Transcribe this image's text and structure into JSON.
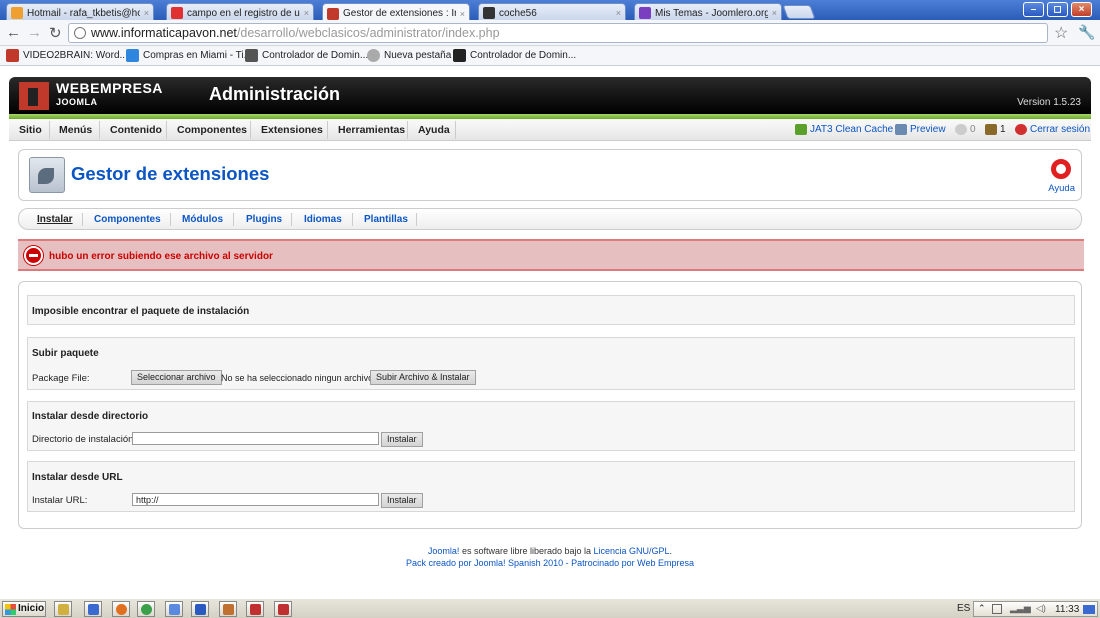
{
  "browser": {
    "tabs": [
      {
        "title": "Hotmail - rafa_tkbetis@hotmai",
        "favicon_color": "#f0a030"
      },
      {
        "title": "campo en el registro de usuari",
        "favicon_color": "#e03030"
      },
      {
        "title": "Gestor de extensiones : Instal",
        "favicon_color": "#c0392b",
        "active": true
      },
      {
        "title": "coche56",
        "favicon_color": "#333333"
      },
      {
        "title": "Mis Temas - Joomlero.org",
        "favicon_color": "#7a3ec0"
      }
    ],
    "tab_close_glyph": "×",
    "url_host": "www.informaticapavon.net",
    "url_path": "/desarrollo/webclasicos/administrator/index.php",
    "bookmarks": [
      {
        "label": "VIDEO2BRAIN: Word...",
        "icon_color": "#c0392b"
      },
      {
        "label": "Compras en Miami - Ti...",
        "icon_color": "#2e86de"
      },
      {
        "label": "Controlador de Domin...",
        "icon_color": "#555555"
      },
      {
        "label": "Nueva pestaña",
        "icon_color": "#aaaaaa"
      },
      {
        "label": "Controlador de Domin...",
        "icon_color": "#222222"
      }
    ]
  },
  "joomla": {
    "brand": "WEBEMPRESA",
    "brand_sub": "JOOMLA",
    "admin_title": "Administración",
    "version": "Version 1.5.23",
    "menu": [
      "Sitio",
      "Menús",
      "Contenido",
      "Componentes",
      "Extensiones",
      "Herramientas",
      "Ayuda"
    ],
    "status": {
      "cache": "JAT3 Clean Cache",
      "preview": "Preview",
      "messages": "0",
      "users": "1",
      "logout": "Cerrar sesión"
    },
    "page_title": "Gestor de extensiones",
    "help_label": "Ayuda",
    "submenu": [
      "Instalar",
      "Componentes",
      "Módulos",
      "Plugins",
      "Idiomas",
      "Plantillas"
    ],
    "error_message": "hubo un error subiendo ese archivo al servidor",
    "install": {
      "notice": "Imposible encontrar el paquete de instalación",
      "upload": {
        "title": "Subir paquete",
        "label": "Package File:",
        "select_button": "Seleccionar archivo",
        "no_file": "No se ha seleccionado ningun archivo",
        "submit_button": "Subir Archivo & Instalar"
      },
      "directory": {
        "title": "Instalar desde directorio",
        "label": "Directorio de instalación:",
        "value": "",
        "button": "Instalar"
      },
      "url": {
        "title": "Instalar desde URL",
        "label": "Instalar URL:",
        "value": "http://",
        "button": "Instalar"
      }
    },
    "footer": {
      "line1_pre": "Joomla!",
      "line1_mid": " es software libre liberado bajo la ",
      "line1_link": "Licencia GNU/GPL",
      "line1_end": ".",
      "line2": "Pack creado por Joomla! Spanish 2010 - Patrocinado por Web Empresa"
    }
  },
  "taskbar": {
    "start": "Inicio",
    "lang": "ES",
    "clock": "11:33",
    "items": [
      "#d0b040",
      "#3a6ad0",
      "#e07020",
      "#3aa04a",
      "#5a8ae0",
      "#2a5ac0",
      "#c07030",
      "#c03030",
      "#c03030"
    ]
  }
}
